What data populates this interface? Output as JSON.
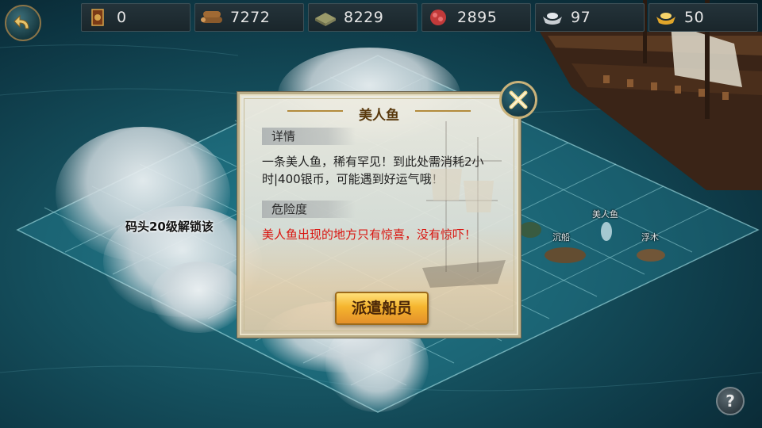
{
  "resources": [
    {
      "icon": "medal-icon",
      "value": "0"
    },
    {
      "icon": "wood-icon",
      "value": "7272"
    },
    {
      "icon": "stone-icon",
      "value": "8229"
    },
    {
      "icon": "meat-icon",
      "value": "2895"
    },
    {
      "icon": "silver-ingot-icon",
      "value": "97"
    },
    {
      "icon": "gold-ingot-icon",
      "value": "50"
    }
  ],
  "map": {
    "lock_label": "码头20级解锁该",
    "spots": [
      {
        "label": "美人鱼"
      },
      {
        "label": "沉船"
      },
      {
        "label": "浮木"
      }
    ]
  },
  "dialog": {
    "title": "美人鱼",
    "details_label": "详情",
    "description": "一条美人鱼，稀有罕见！到此处需消耗2小时|400银币，可能遇到好运气哦！",
    "danger_label": "危险度",
    "danger_text": "美人鱼出现的地方只有惊喜，没有惊吓！",
    "dispatch_label": "派遣船员"
  },
  "help_label": "?",
  "colors": {
    "accent": "#f5b52e",
    "danger": "#d9140f",
    "title": "#5a3a0e"
  }
}
